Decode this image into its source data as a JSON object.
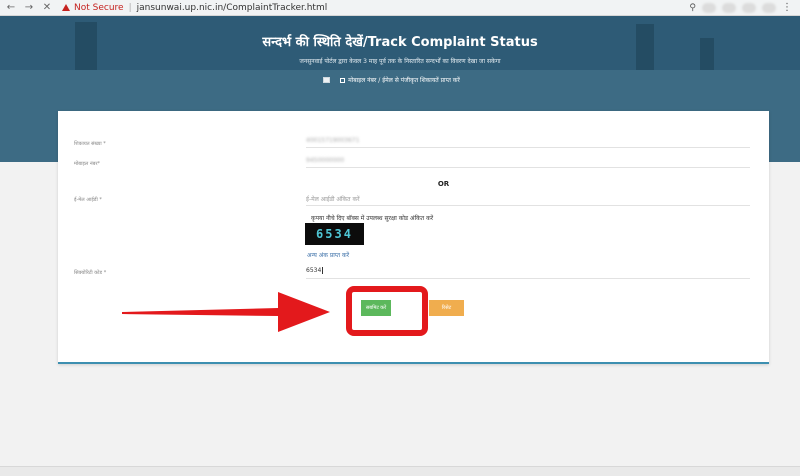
{
  "browser": {
    "not_secure": "Not Secure",
    "url": "jansunwai.up.nic.in/ComplaintTracker.html"
  },
  "header": {
    "title": "सन्दर्भ की स्थिति देखें/Track Complaint Status",
    "subtitle": "जनसुनवाई पोर्टल द्वारा केवल 3 माह पूर्व तक के निस्तारित सन्दर्भों का विवरण देखा जा सकेगा",
    "link": "मोबाइल नंबर / ईमेल से पंजीकृत शिकायतें प्राप्त करें"
  },
  "form": {
    "complaint_no_label": "शिकायत संख्या *",
    "complaint_no_value": "40015719003671",
    "mobile_label": "मोबाइल नंबर*",
    "mobile_value": "9450000000",
    "or_text": "OR",
    "email_label": "ई-मेल आईडी *",
    "email_placeholder": "ई-मेल आईडी अंकित करें",
    "captcha_instruction": "कृपया नीचे दिए बॉक्स में उपलब्ध सुरक्षा कोड अंकित करें",
    "captcha_code": "6534",
    "refresh_link": "अन्य अंक प्राप्त करें",
    "security_label": "सिक्योरिटी कोड *",
    "security_value": "6534",
    "submit_label": "सबमिट करें",
    "reset_label": "रिसेट"
  },
  "colors": {
    "banner": "#3d6b84",
    "submit": "#5cb85c",
    "reset": "#f0ad4e",
    "highlight": "#e3191c"
  }
}
